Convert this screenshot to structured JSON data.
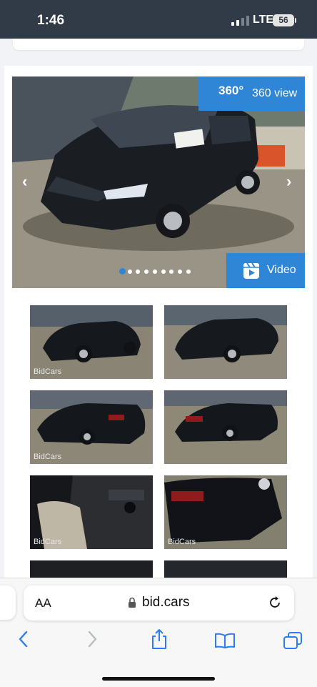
{
  "status_bar": {
    "time": "1:46",
    "network": "LTE",
    "battery": "56"
  },
  "gallery": {
    "badge_360": {
      "icon_text": "360°",
      "label": "360 view"
    },
    "video_button": {
      "label": "Video"
    },
    "slide_count": 9,
    "active_slide": 1,
    "watermark": "BidCars"
  },
  "browser": {
    "text_size_label": "AA",
    "url": "bid.cars",
    "accent_color": "#2f7bf5"
  }
}
